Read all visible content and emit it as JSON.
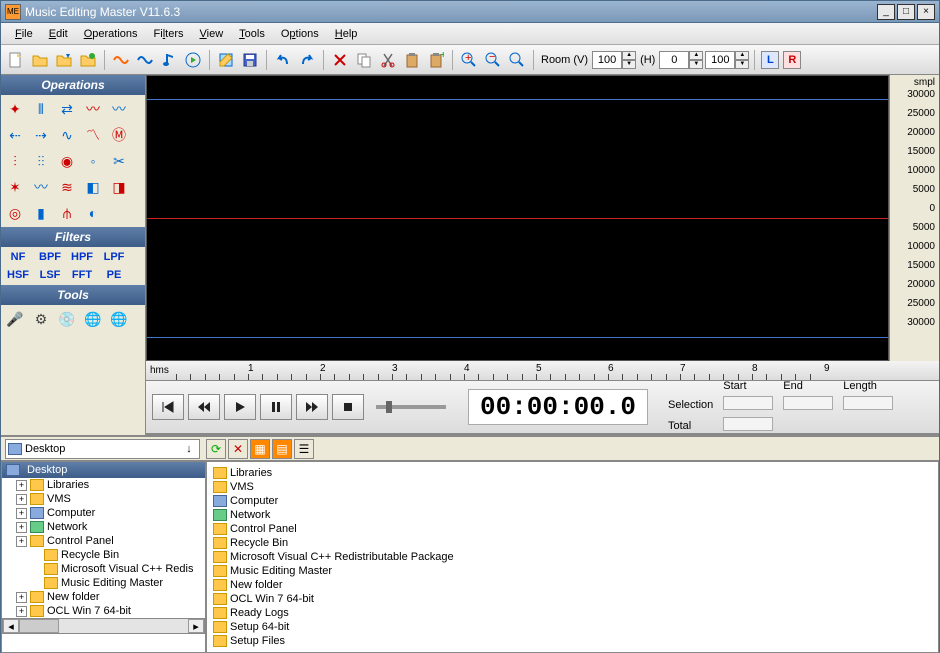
{
  "app": {
    "title": "Music Editing Master V11.6.3",
    "icon": "ME"
  },
  "menu": [
    "File",
    "Edit",
    "Operations",
    "Filters",
    "View",
    "Tools",
    "Options",
    "Help"
  ],
  "toolbar": {
    "room_v_label": "Room (V)",
    "room_v_value": "100",
    "h_label": "(H)",
    "h_val1": "0",
    "h_val2": "100",
    "l_label": "L",
    "r_label": "R"
  },
  "panels": {
    "operations": "Operations",
    "filters": "Filters",
    "tools": "Tools"
  },
  "filters": [
    "NF",
    "BPF",
    "HPF",
    "LPF",
    "HSF",
    "LSF",
    "FFT",
    "PE"
  ],
  "yaxis": {
    "unit": "smpl",
    "labels": [
      "30000",
      "25000",
      "20000",
      "15000",
      "10000",
      "5000",
      "0",
      "5000",
      "10000",
      "15000",
      "20000",
      "25000",
      "30000"
    ]
  },
  "ruler": {
    "unit": "hms",
    "marks": [
      "1",
      "2",
      "3",
      "4",
      "5",
      "6",
      "7",
      "8",
      "9"
    ]
  },
  "transport": {
    "timecode": "00:00:00.0"
  },
  "selection": {
    "sel_label": "Selection",
    "total_label": "Total",
    "start_label": "Start",
    "end_label": "End",
    "length_label": "Length"
  },
  "browser": {
    "path_label": "Desktop",
    "root_label": "Desktop",
    "tree": [
      {
        "label": "Libraries",
        "icon": "folder",
        "expand": true
      },
      {
        "label": "VMS",
        "icon": "folder",
        "expand": true
      },
      {
        "label": "Computer",
        "icon": "comp",
        "expand": true
      },
      {
        "label": "Network",
        "icon": "net",
        "expand": true
      },
      {
        "label": "Control Panel",
        "icon": "folder",
        "expand": true
      },
      {
        "label": "Recycle Bin",
        "icon": "folder",
        "expand": false,
        "indent": true
      },
      {
        "label": "Microsoft Visual C++ Redis",
        "icon": "folder",
        "expand": false,
        "indent": true
      },
      {
        "label": "Music Editing Master",
        "icon": "folder",
        "expand": false,
        "indent": true
      },
      {
        "label": "New folder",
        "icon": "folder",
        "expand": true
      },
      {
        "label": "OCL Win 7 64-bit",
        "icon": "folder",
        "expand": true
      }
    ],
    "files_col1": [
      {
        "label": "Libraries",
        "icon": "folder"
      },
      {
        "label": "VMS",
        "icon": "folder"
      },
      {
        "label": "Computer",
        "icon": "comp"
      },
      {
        "label": "Network",
        "icon": "net"
      },
      {
        "label": "Control Panel",
        "icon": "folder"
      },
      {
        "label": "Recycle Bin",
        "icon": "folder"
      },
      {
        "label": "Microsoft Visual C++ Redistributable Package",
        "icon": "folder"
      },
      {
        "label": "Music Editing Master",
        "icon": "folder"
      },
      {
        "label": "New folder",
        "icon": "folder"
      },
      {
        "label": "OCL Win 7 64-bit",
        "icon": "folder"
      }
    ],
    "files_col2": [
      {
        "label": "Ready Logs",
        "icon": "folder"
      },
      {
        "label": "Setup 64-bit",
        "icon": "folder"
      },
      {
        "label": "Setup Files",
        "icon": "folder"
      }
    ]
  }
}
